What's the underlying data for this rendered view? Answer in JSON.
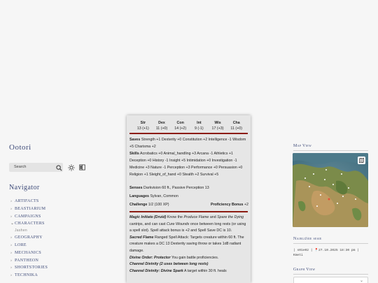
{
  "sidebar": {
    "brand": "Ootori",
    "search_placeholder": "Search",
    "navigator_title": "Navigator",
    "items": [
      {
        "label": "artifacts",
        "chev": "›"
      },
      {
        "label": "beastiarium",
        "chev": "›"
      },
      {
        "label": "campaigns",
        "chev": "›"
      },
      {
        "label": "characters",
        "chev": "⌄"
      },
      {
        "label": "Jashen",
        "sub": true
      },
      {
        "label": "geography",
        "chev": "›"
      },
      {
        "label": "lore",
        "chev": "›"
      },
      {
        "label": "mechanics",
        "chev": "›"
      },
      {
        "label": "pantheon",
        "chev": "›"
      },
      {
        "label": "shortstories",
        "chev": "›"
      },
      {
        "label": "technika",
        "chev": "›"
      }
    ]
  },
  "statblock": {
    "abilities": [
      {
        "name": "Str",
        "val": "13 (+1)"
      },
      {
        "name": "Dex",
        "val": "11 (+0)"
      },
      {
        "name": "Con",
        "val": "14 (+2)"
      },
      {
        "name": "Int",
        "val": "9 (-1)"
      },
      {
        "name": "Wis",
        "val": "17 (+3)"
      },
      {
        "name": "Cha",
        "val": "11 (+0)"
      }
    ],
    "saves_label": "Saves",
    "saves": "Strength +1 Dexterity +0 Constitution +2 Intelligence -1 Wisdom +5 Charisma +2",
    "skills_label": "Skills",
    "skills": "Acrobatics +0 Animal_handling +3 Arcana -1 Athletics +1 Deception +0 History -1 Insight +5 Intimidation +0 Investigation -1 Medicine +3 Nature -1 Perception +3 Performance +0 Persuasion +0 Religion +1 Sleight_of_hand +0 Stealth +2 Survival +5",
    "senses_label": "Senses",
    "senses": "Darkvision 60 ft., Passive Perception 13",
    "languages_label": "Languages",
    "languages": "Sylvan, Common",
    "challenge_label": "Challenge",
    "challenge": "1/2 (100 XP)",
    "prof_label": "Proficiency Bonus",
    "prof": "+2",
    "traits": [
      {
        "name": "Magic Initiate (Druid)",
        "pre": "Know the ",
        "em1": "Produce Flame",
        "mid": " and ",
        "em2": "Spare the Dying",
        "rest": " cantrips, and can cast ",
        "em3": "Cure Wounds",
        "tail": " once between long rests (or using a spell slot). Spell attack bonus is +2 and Spell Save DC is 10."
      },
      {
        "name": "Sacred Flame",
        "text": "Ranged Spell Attack: Targets creature within 60 ft. The creature makes a DC 13 Dexterity saving throw or takes 1d8 radiant damage."
      },
      {
        "name": "Divine Order: Protector",
        "text": "You gain battle proficiencies."
      },
      {
        "name": "Channel Divinity (2 uses between long rests)",
        "text": ""
      },
      {
        "name": "Channel Divinity: Divine Spark",
        "text": "A target within 30 ft. heals"
      }
    ]
  },
  "right": {
    "map_title": "Map View",
    "recent_title": "Najbližšie sesie",
    "recent_text": "| s01e02 | 📍27.10.2025 18:30 pm | Kmeti",
    "graph_title": "Graph View"
  }
}
